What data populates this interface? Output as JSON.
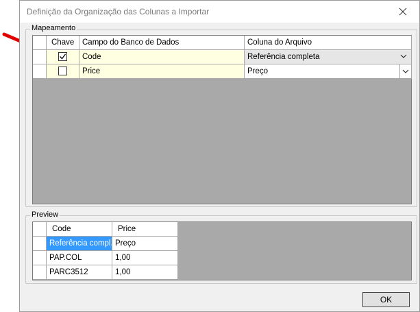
{
  "window": {
    "title": "Definição da Organização das Colunas a Importar"
  },
  "mapping": {
    "group_label": "Mapeamento",
    "columns": [
      "Chave",
      "Campo do Banco de Dados",
      "Coluna do Arquivo"
    ],
    "rows": [
      {
        "checked": true,
        "field": "Code",
        "file_column": "Referência completa"
      },
      {
        "checked": false,
        "field": "Price",
        "file_column": "Preço"
      }
    ]
  },
  "preview": {
    "group_label": "Preview",
    "columns": [
      "Code",
      "Price"
    ],
    "rows": [
      [
        "Referência compl...",
        "Preço"
      ],
      [
        "PAP.COL",
        "1,00"
      ],
      [
        "PARC3512",
        "1,00"
      ]
    ]
  },
  "buttons": {
    "ok": "OK"
  },
  "colors": {
    "annotation_arrow": "#e00000",
    "selection": "#3399ff",
    "key_field_bg": "#ffffe1"
  }
}
